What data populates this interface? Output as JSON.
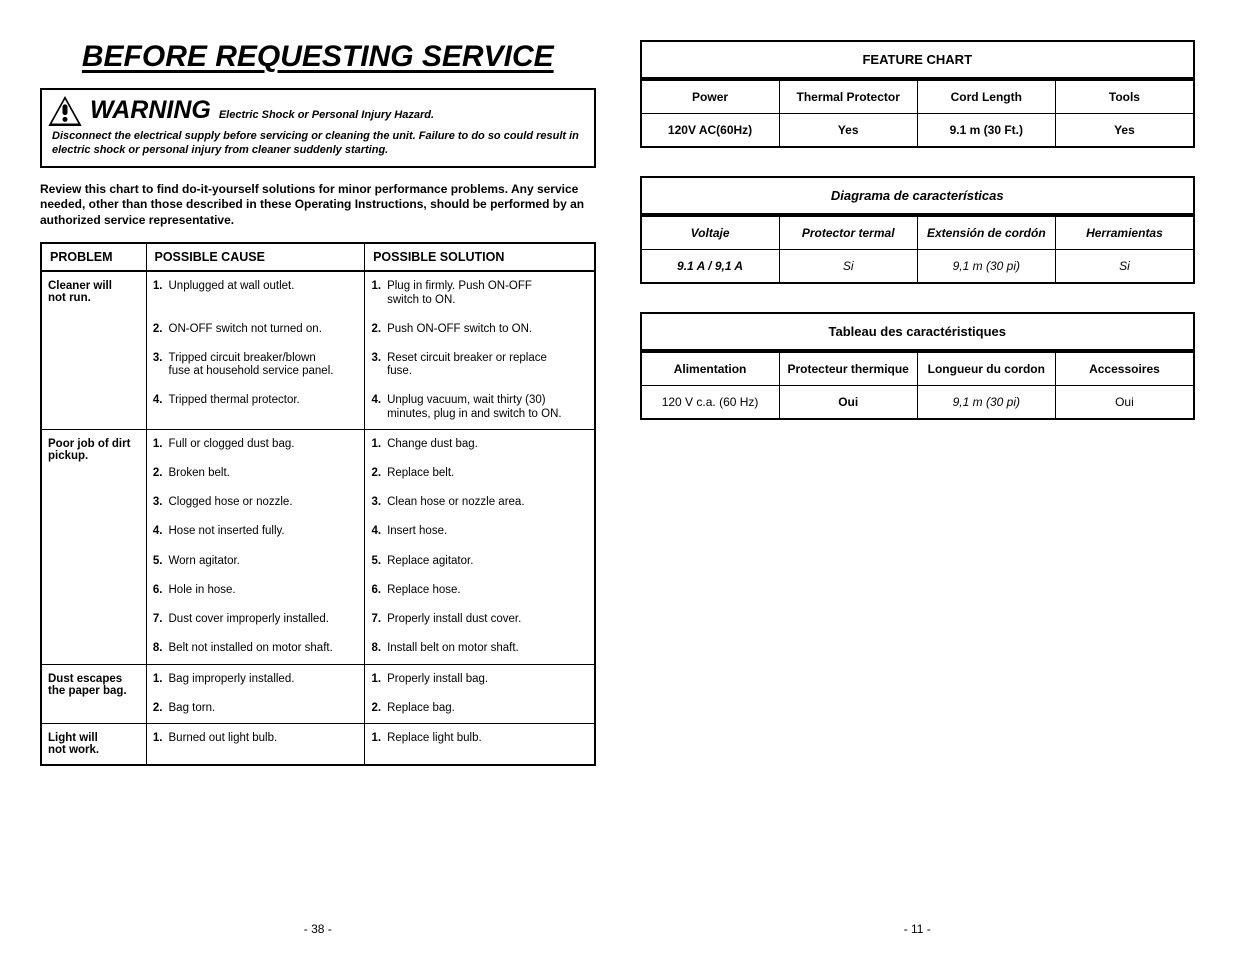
{
  "left": {
    "title": "BEFORE REQUESTING SERVICE",
    "warning": {
      "word": "WARNING",
      "hazard": "Electric Shock or Personal Injury Hazard.",
      "body": "Disconnect the electrical supply before servicing or cleaning the unit.  Failure to do so could result in electric shock or personal injury from cleaner suddenly starting."
    },
    "intro": "Review this chart to find do-it-yourself solutions for minor performance problems. Any service needed, other than those described in these Operating Instructions, should be performed by an authorized service representative.",
    "trouble": {
      "headers": {
        "problem": "PROBLEM",
        "cause": "POSSIBLE CAUSE",
        "solution": "POSSIBLE SOLUTION"
      },
      "sections": [
        {
          "problem_l1": "Cleaner will",
          "problem_l2": "not run.",
          "rows": [
            {
              "n": "1.",
              "cause": "Unplugged at wall outlet.",
              "sn": "1.",
              "sol_l1": "Plug in firmly. Push ON-OFF",
              "sol_l2": "switch to ON."
            },
            {
              "n": "2.",
              "cause": "ON-OFF switch not turned on.",
              "sn": "2.",
              "sol": "Push ON-OFF switch to ON."
            },
            {
              "n": "3.",
              "cause_l1": "Tripped circuit breaker/blown",
              "cause_l2": "fuse at household service panel.",
              "sn": "3.",
              "sol_l1": "Reset circuit breaker or replace",
              "sol_l2": "fuse."
            },
            {
              "n": "4.",
              "cause": "Tripped thermal protector.",
              "sn": "4.",
              "sol_l1": "Unplug vacuum, wait thirty (30)",
              "sol_l2": "minutes, plug in and switch to ON."
            }
          ]
        },
        {
          "problem_l1": "Poor job of dirt",
          "problem_l2": "pickup.",
          "rows": [
            {
              "n": "1.",
              "cause": "Full or clogged dust bag.",
              "sn": "1.",
              "sol": "Change dust bag."
            },
            {
              "n": "2.",
              "cause": "Broken belt.",
              "sn": "2.",
              "sol": "Replace belt."
            },
            {
              "n": "3.",
              "cause": "Clogged hose or nozzle.",
              "sn": "3.",
              "sol": "Clean hose or nozzle area."
            },
            {
              "n": "4.",
              "cause": "Hose not inserted fully.",
              "sn": "4.",
              "sol": "Insert hose."
            },
            {
              "n": "5.",
              "cause": "Worn agitator.",
              "sn": "5.",
              "sol": "Replace agitator."
            },
            {
              "n": "6.",
              "cause": "Hole in hose.",
              "sn": "6.",
              "sol": "Replace hose."
            },
            {
              "n": "7.",
              "cause": "Dust cover improperly installed.",
              "sn": "7.",
              "sol": "Properly install dust cover."
            },
            {
              "n": "8.",
              "cause": "Belt not installed on motor shaft.",
              "sn": "8.",
              "sol": "Install belt on motor shaft."
            }
          ]
        },
        {
          "problem_l1": "Dust escapes",
          "problem_l2": "the paper bag.",
          "rows": [
            {
              "n": "1.",
              "cause": "Bag improperly installed.",
              "sn": "1.",
              "sol": "Properly install bag."
            },
            {
              "n": "2.",
              "cause": "Bag torn.",
              "sn": "2.",
              "sol": "Replace bag."
            }
          ]
        },
        {
          "problem_l1": "Light will",
          "problem_l2": "not work.",
          "rows": [
            {
              "n": "1.",
              "cause": "Burned out light bulb.",
              "sn": "1.",
              "sol": "Replace light bulb."
            }
          ]
        }
      ]
    },
    "page": "- 38 -"
  },
  "right": {
    "en": {
      "title": "FEATURE CHART",
      "h": [
        "Power",
        "Thermal Protector",
        "Cord Length",
        "Tools"
      ],
      "v": [
        "120V AC(60Hz)",
        "Yes",
        "9.1 m (30 Ft.)",
        "Yes"
      ]
    },
    "es": {
      "title": "Diagrama de características",
      "h": [
        "Voltaje",
        "Protector termal",
        "Extensión de cordón",
        "Herramientas"
      ],
      "v": [
        "9.1 A / 9,1 A",
        "Si",
        "9,1 m (30 pi)",
        "Si"
      ]
    },
    "fr": {
      "title": "Tableau des caractéristiques",
      "h": [
        "Alimentation",
        "Protecteur thermique",
        "Longueur du cordon",
        "Accessoires"
      ],
      "v": [
        "120 V c.a. (60 Hz)",
        "Oui",
        "9,1 m (30 pi)",
        "Oui"
      ]
    },
    "page": "- 11 -"
  }
}
